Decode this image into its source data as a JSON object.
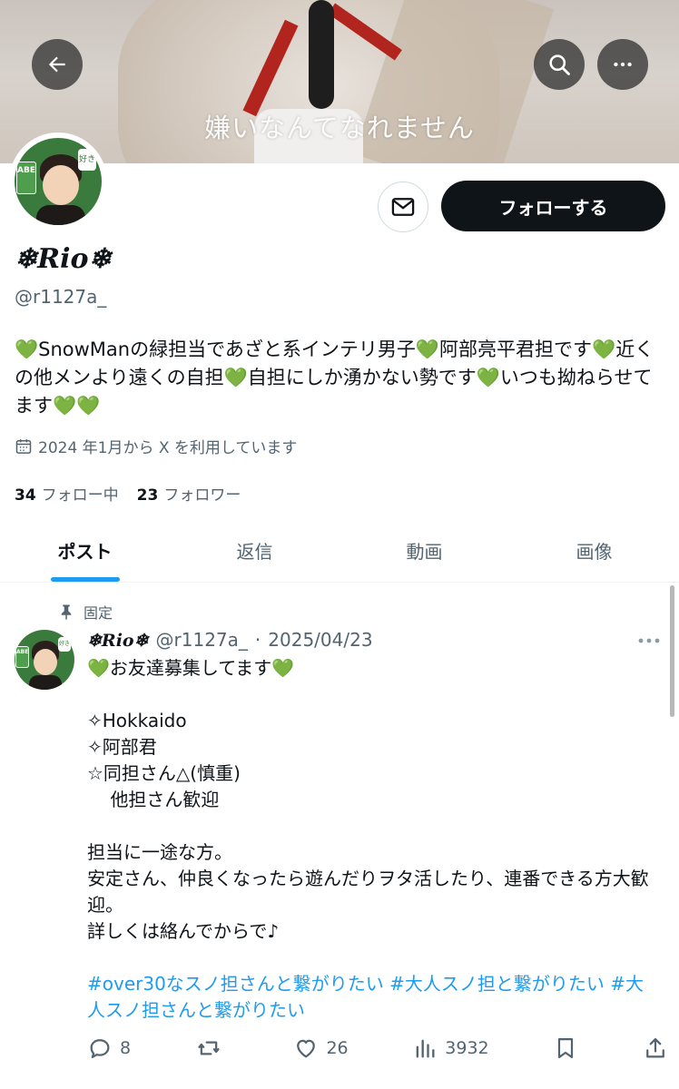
{
  "header": {
    "banner_caption": "嫌いなんてなれません"
  },
  "profile": {
    "display_name": "❄𝑹𝒊𝒐❄",
    "handle": "@r1127a_",
    "bio": "💚SnowManの緑担当であざと系インテリ男子💚阿部亮平君担です💚近くの他メンより遠くの自担💚自担にしか湧かない勢です💚いつも拗ねらせてます💚💚",
    "joined": "2024 年1月から X を利用しています",
    "following_count": "34",
    "following_label": "フォロー中",
    "followers_count": "23",
    "followers_label": "フォロワー",
    "follow_label": "フォローする",
    "avatar_tag": "ABE",
    "avatar_bubble": "好き"
  },
  "tabs": [
    {
      "label": "ポスト",
      "active": true
    },
    {
      "label": "返信",
      "active": false
    },
    {
      "label": "動画",
      "active": false
    },
    {
      "label": "画像",
      "active": false
    }
  ],
  "post": {
    "pinned_label": "固定",
    "author_name": "❄𝑹𝒊𝒐❄",
    "author_handle": "@r1127a_",
    "separator": "·",
    "date": "2025/04/23",
    "body": "💚お友達募集してます💚\n\n✧Hokkaido\n✧阿部君\n☆同担さん△(慎重)\n    他担さん歓迎\n\n担当に一途な方。\n安定さん、仲良くなったら遊んだりヲタ活したり、連番できる方大歓迎。\n詳しくは絡んでからで♪",
    "hashtags": [
      "#over30なスノ担さんと繋がりたい",
      "#大人スノ担と繋がりたい",
      "#大人スノ担さんと繋がりたい"
    ],
    "replies": "8",
    "retweets": "",
    "likes": "26",
    "views": "3932"
  },
  "colors": {
    "accent": "#1d9bf0",
    "text": "#0f1419",
    "muted": "#536471",
    "avatar_green": "#3a7a3d"
  },
  "icons": [
    "back-arrow-icon",
    "search-icon",
    "more-icon",
    "mail-icon",
    "calendar-icon",
    "pin-icon",
    "reply-icon",
    "retweet-icon",
    "heart-icon",
    "views-icon",
    "bookmark-icon",
    "share-icon"
  ]
}
